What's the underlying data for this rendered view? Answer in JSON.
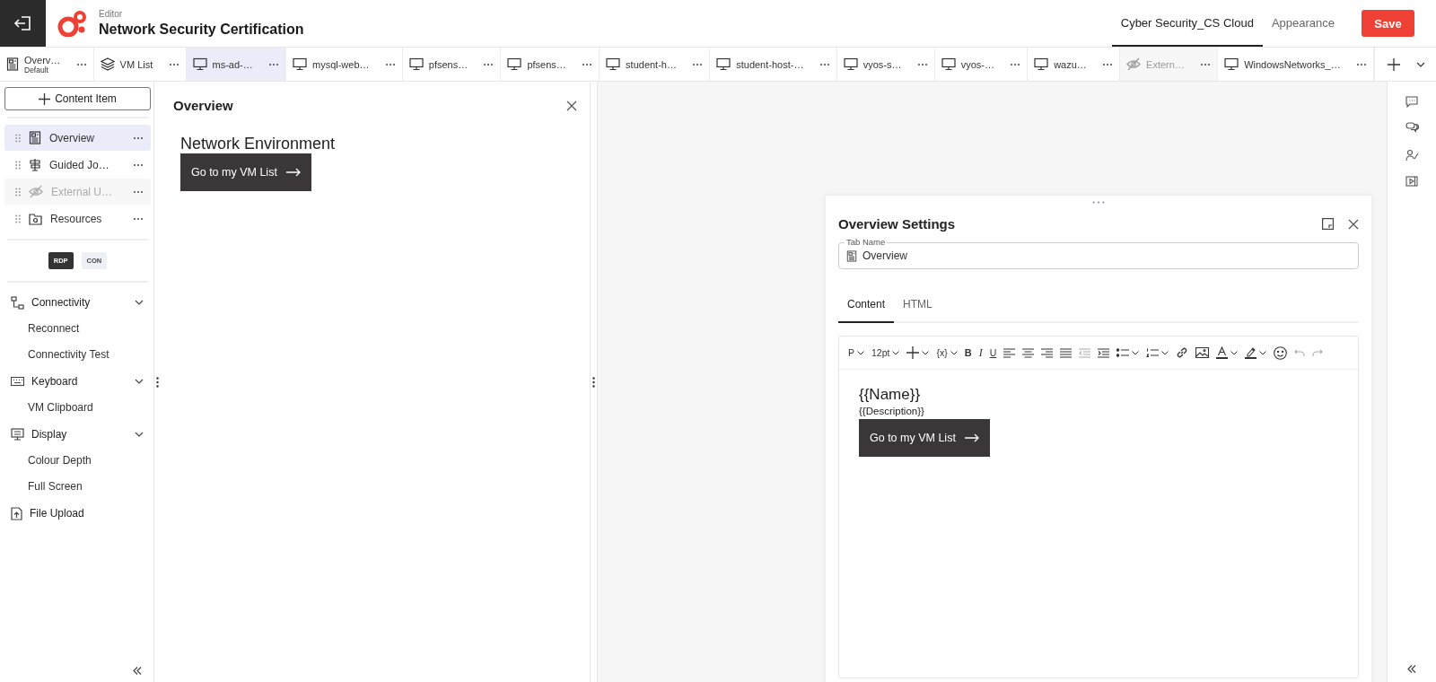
{
  "header": {
    "section": "Editor",
    "title": "Network Security Certification",
    "nav": [
      {
        "label": "Cyber Security_CS Cloud",
        "selected": true
      },
      {
        "label": "Appearance",
        "selected": false
      }
    ],
    "save": "Save"
  },
  "tabs": [
    {
      "kind": "page",
      "label": "Overv…",
      "sub": "Default",
      "selected": false,
      "disabled": false
    },
    {
      "kind": "list",
      "label": "VM List",
      "selected": false,
      "disabled": false
    },
    {
      "kind": "vm",
      "label": "ms-ad-…",
      "selected": true,
      "disabled": false
    },
    {
      "kind": "vm",
      "label": "mysql-web…",
      "selected": false,
      "disabled": false
    },
    {
      "kind": "vm",
      "label": "pfsens…",
      "selected": false,
      "disabled": false
    },
    {
      "kind": "vm",
      "label": "pfsens…",
      "selected": false,
      "disabled": false
    },
    {
      "kind": "vm",
      "label": "student-h…",
      "selected": false,
      "disabled": false
    },
    {
      "kind": "vm",
      "label": "student-host-…",
      "selected": false,
      "disabled": false
    },
    {
      "kind": "vm",
      "label": "vyos-s…",
      "selected": false,
      "disabled": false
    },
    {
      "kind": "vm",
      "label": "vyos-…",
      "selected": false,
      "disabled": false
    },
    {
      "kind": "vm",
      "label": "wazu…",
      "selected": false,
      "disabled": false
    },
    {
      "kind": "hidden",
      "label": "Extern…",
      "selected": false,
      "disabled": true
    },
    {
      "kind": "vm",
      "label": "WindowsNetworks_…",
      "selected": false,
      "disabled": false
    }
  ],
  "sidebar": {
    "add_button": "Content Item",
    "items": [
      {
        "kind": "page",
        "label": "Overview",
        "selected": true,
        "disabled": false
      },
      {
        "kind": "guide",
        "label": "Guided Jo…",
        "selected": false,
        "disabled": false
      },
      {
        "kind": "hidden",
        "label": "External U…",
        "selected": false,
        "disabled": true
      },
      {
        "kind": "folder",
        "label": "Resources",
        "selected": false,
        "disabled": false
      }
    ],
    "modes": [
      {
        "label": "RDP",
        "selected": true
      },
      {
        "label": "CON",
        "selected": false
      }
    ],
    "tools": [
      {
        "kind": "connectivity",
        "label": "Connectivity",
        "expanded": true,
        "children": [
          "Reconnect",
          "Connectivity Test"
        ]
      },
      {
        "kind": "keyboard",
        "label": "Keyboard",
        "expanded": true,
        "children": [
          "VM Clipboard"
        ]
      },
      {
        "kind": "display",
        "label": "Display",
        "expanded": true,
        "children": [
          "Colour Depth",
          "Full Screen"
        ]
      },
      {
        "kind": "upload",
        "label": "File Upload"
      }
    ]
  },
  "preview": {
    "title": "Overview",
    "heading": "Network Environment",
    "button": "Go to my VM List"
  },
  "settings": {
    "title": "Overview Settings",
    "field_label": "Tab Name",
    "field_value": "Overview",
    "tabs": [
      {
        "label": "Content",
        "selected": true
      },
      {
        "label": "HTML",
        "selected": false
      }
    ],
    "toolbar": [
      {
        "kind": "text",
        "label": "P",
        "dropdown": true,
        "disabled": false
      },
      {
        "kind": "text",
        "label": "12pt",
        "dropdown": true,
        "disabled": false
      },
      {
        "kind": "insert",
        "dropdown": true,
        "disabled": false
      },
      {
        "kind": "text",
        "label": "{x}",
        "dropdown": true,
        "disabled": false
      },
      {
        "kind": "bold",
        "label": "B",
        "dropdown": false,
        "disabled": false
      },
      {
        "kind": "italic",
        "label": "I",
        "dropdown": false,
        "disabled": false
      },
      {
        "kind": "underline",
        "label": "U",
        "dropdown": false,
        "disabled": false
      },
      {
        "kind": "align-left",
        "dropdown": false,
        "disabled": false
      },
      {
        "kind": "align-center",
        "dropdown": false,
        "disabled": false
      },
      {
        "kind": "align-right",
        "dropdown": false,
        "disabled": false
      },
      {
        "kind": "justify",
        "dropdown": false,
        "disabled": false
      },
      {
        "kind": "outdent",
        "dropdown": false,
        "disabled": true
      },
      {
        "kind": "indent",
        "dropdown": false,
        "disabled": false
      },
      {
        "kind": "bullets",
        "dropdown": true,
        "disabled": false
      },
      {
        "kind": "numbering",
        "dropdown": true,
        "disabled": false
      },
      {
        "kind": "link",
        "dropdown": false,
        "disabled": false
      },
      {
        "kind": "image",
        "dropdown": false,
        "disabled": false
      },
      {
        "kind": "font-color",
        "dropdown": true,
        "disabled": false
      },
      {
        "kind": "highlight",
        "dropdown": true,
        "disabled": false
      },
      {
        "kind": "emoji",
        "dropdown": false,
        "disabled": false
      },
      {
        "kind": "undo",
        "dropdown": false,
        "disabled": true
      },
      {
        "kind": "redo",
        "dropdown": false,
        "disabled": true
      }
    ],
    "editor": {
      "name": "{{Name}}",
      "description": "{{Description}}",
      "button": "Go to my VM List"
    }
  }
}
